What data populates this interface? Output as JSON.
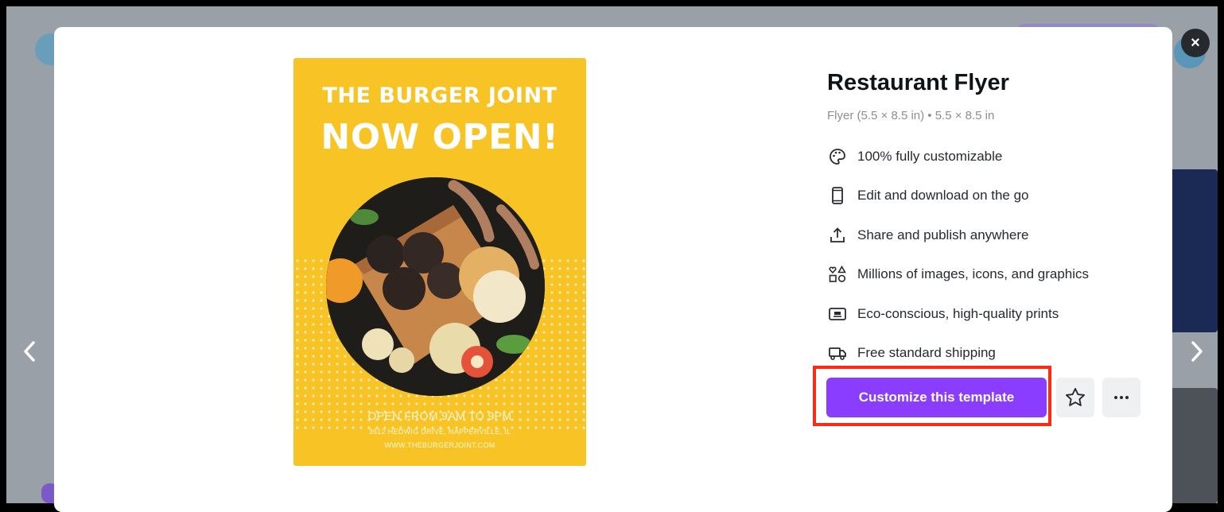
{
  "template": {
    "title": "Restaurant Flyer",
    "subtitle": "Flyer (5.5 × 8.5 in) • 5.5 × 8.5 in"
  },
  "flyer": {
    "headline_1": "THE BURGER JOINT",
    "headline_2": "NOW OPEN!",
    "hours": "OPEN FROM 9AM TO 9PM",
    "address": "3612 HEDWIG DRIVE, NAPPERVILLE, IL",
    "website": "WWW.THEBURGERJOINT.COM",
    "background_color": "#f8c324"
  },
  "features": [
    {
      "icon": "palette-icon",
      "label": "100% fully customizable"
    },
    {
      "icon": "phone-icon",
      "label": "Edit and download on the go"
    },
    {
      "icon": "share-upload-icon",
      "label": "Share and publish anywhere"
    },
    {
      "icon": "shapes-icon",
      "label": "Millions of images, icons, and graphics"
    },
    {
      "icon": "print-icon",
      "label": "Eco-conscious, high-quality prints"
    },
    {
      "icon": "truck-icon",
      "label": "Free standard shipping"
    }
  ],
  "actions": {
    "customize_label": "Customize this template",
    "star_icon": "star-icon",
    "more_icon": "more-dots-icon",
    "accent_color": "#8b3dff",
    "highlight_color": "#ff2a14"
  },
  "controls": {
    "close_icon": "close-icon",
    "close_glyph": "×",
    "prev_icon": "chevron-left-icon",
    "next_icon": "chevron-right-icon"
  }
}
